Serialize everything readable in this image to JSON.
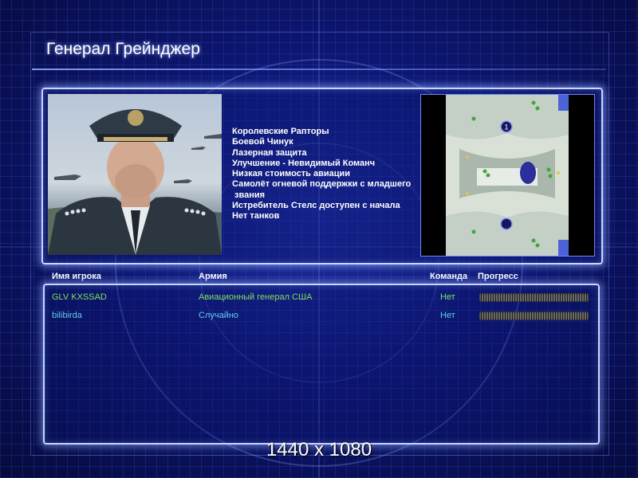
{
  "title": "Генерал Грейнджер",
  "general_features": [
    "Королевские Рапторы",
    "Боевой Чинук",
    "Лазерная защита",
    "Улучшение - Невидимый Команч",
    "Низкая стоимость авиации",
    "Самолёт огневой поддержки с младшего",
    " звания",
    "Истребитель Стелс доступен с начала",
    "Нет танков"
  ],
  "minimap": {
    "start_markers": [
      "1",
      ""
    ]
  },
  "table": {
    "headers": {
      "name": "Имя игрока",
      "army": "Армия",
      "team": "Команда",
      "progress": "Прогресс"
    },
    "players": [
      {
        "name": "GLV KXSSAD",
        "army": "Авиационный генерал США",
        "team": "Нет",
        "progress": 0,
        "color": "#7fe05a"
      },
      {
        "name": "bilibirda",
        "army": "Случайно",
        "team": "Нет",
        "progress": 0,
        "color": "#5fd0e8"
      }
    ]
  },
  "caption": "1440 x 1080"
}
